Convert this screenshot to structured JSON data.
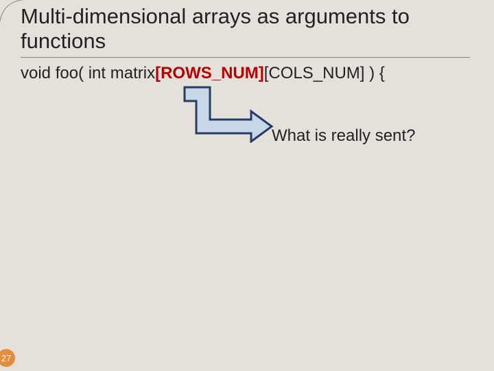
{
  "slide": {
    "title": "Multi-dimensional arrays as arguments to functions",
    "code": {
      "prefix": "void foo( int matrix",
      "highlighted": "[ROWS_NUM]",
      "suffix": "[COLS_NUM] ) {"
    },
    "question": "What is really sent?",
    "page_number": "27"
  }
}
